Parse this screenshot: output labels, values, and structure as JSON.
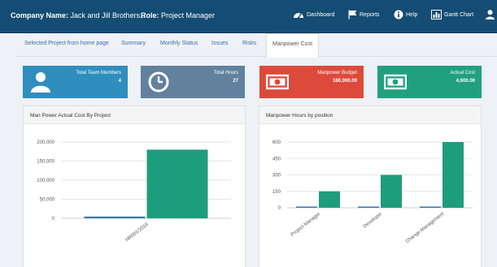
{
  "header": {
    "company_label": "Company Name:",
    "company_value": "Jack and Jill Brothers..",
    "role_label": "Role:",
    "role_value": "Project Manager",
    "nav": [
      {
        "label": "Dashboard",
        "icon": "dashboard-icon"
      },
      {
        "label": "Reports",
        "icon": "flag-icon"
      },
      {
        "label": "Help",
        "icon": "info-icon"
      },
      {
        "label": "Gantt Chart",
        "icon": "bar-chart-icon"
      }
    ],
    "user_icon": "user-icon"
  },
  "tabs": [
    {
      "label": "Selected Project from home page",
      "active": false
    },
    {
      "label": "Summary",
      "active": false
    },
    {
      "label": "Monthly Status",
      "active": false
    },
    {
      "label": "Issues",
      "active": false
    },
    {
      "label": "Risks",
      "active": false
    },
    {
      "label": "Manpower Cost",
      "active": true
    }
  ],
  "cards": [
    {
      "label": "Total Team Members",
      "value": "4",
      "icon": "user-icon",
      "color": "#2f8ebe"
    },
    {
      "label": "Total Hours",
      "value": "27",
      "icon": "clock-icon",
      "color": "#61819e"
    },
    {
      "label": "Manpower Budget",
      "value": "180,000.00",
      "icon": "money-icon",
      "color": "#dd4a3c"
    },
    {
      "label": "Actual Cost",
      "value": "4,600.00",
      "icon": "money-icon",
      "color": "#1fa17e"
    }
  ],
  "colors": {
    "header_bg": "#154c73",
    "series_green": "#1e9d7c",
    "series_blue": "#3a77a8"
  },
  "chart_data": [
    {
      "type": "bar",
      "title": "Man Power Actual Cost By Project",
      "categories": [
        "HR001/2016"
      ],
      "series": [
        {
          "values": [
            4600
          ]
        },
        {
          "values": [
            180000
          ]
        }
      ],
      "yticks": [
        "200,000",
        "150,000",
        "100,000",
        "50,000",
        "0"
      ],
      "ylim": [
        0,
        200000
      ],
      "grid": true
    },
    {
      "type": "bar",
      "title": "Manpower Hours by position",
      "categories": [
        "Project Manager",
        "Developer",
        "Change Management"
      ],
      "series": [
        {
          "values": [
            5,
            5,
            5
          ]
        },
        {
          "values": [
            150,
            300,
            600
          ]
        }
      ],
      "yticks": [
        "600",
        "450",
        "300",
        "150",
        "0"
      ],
      "ylim": [
        0,
        600
      ],
      "grid": true
    }
  ]
}
